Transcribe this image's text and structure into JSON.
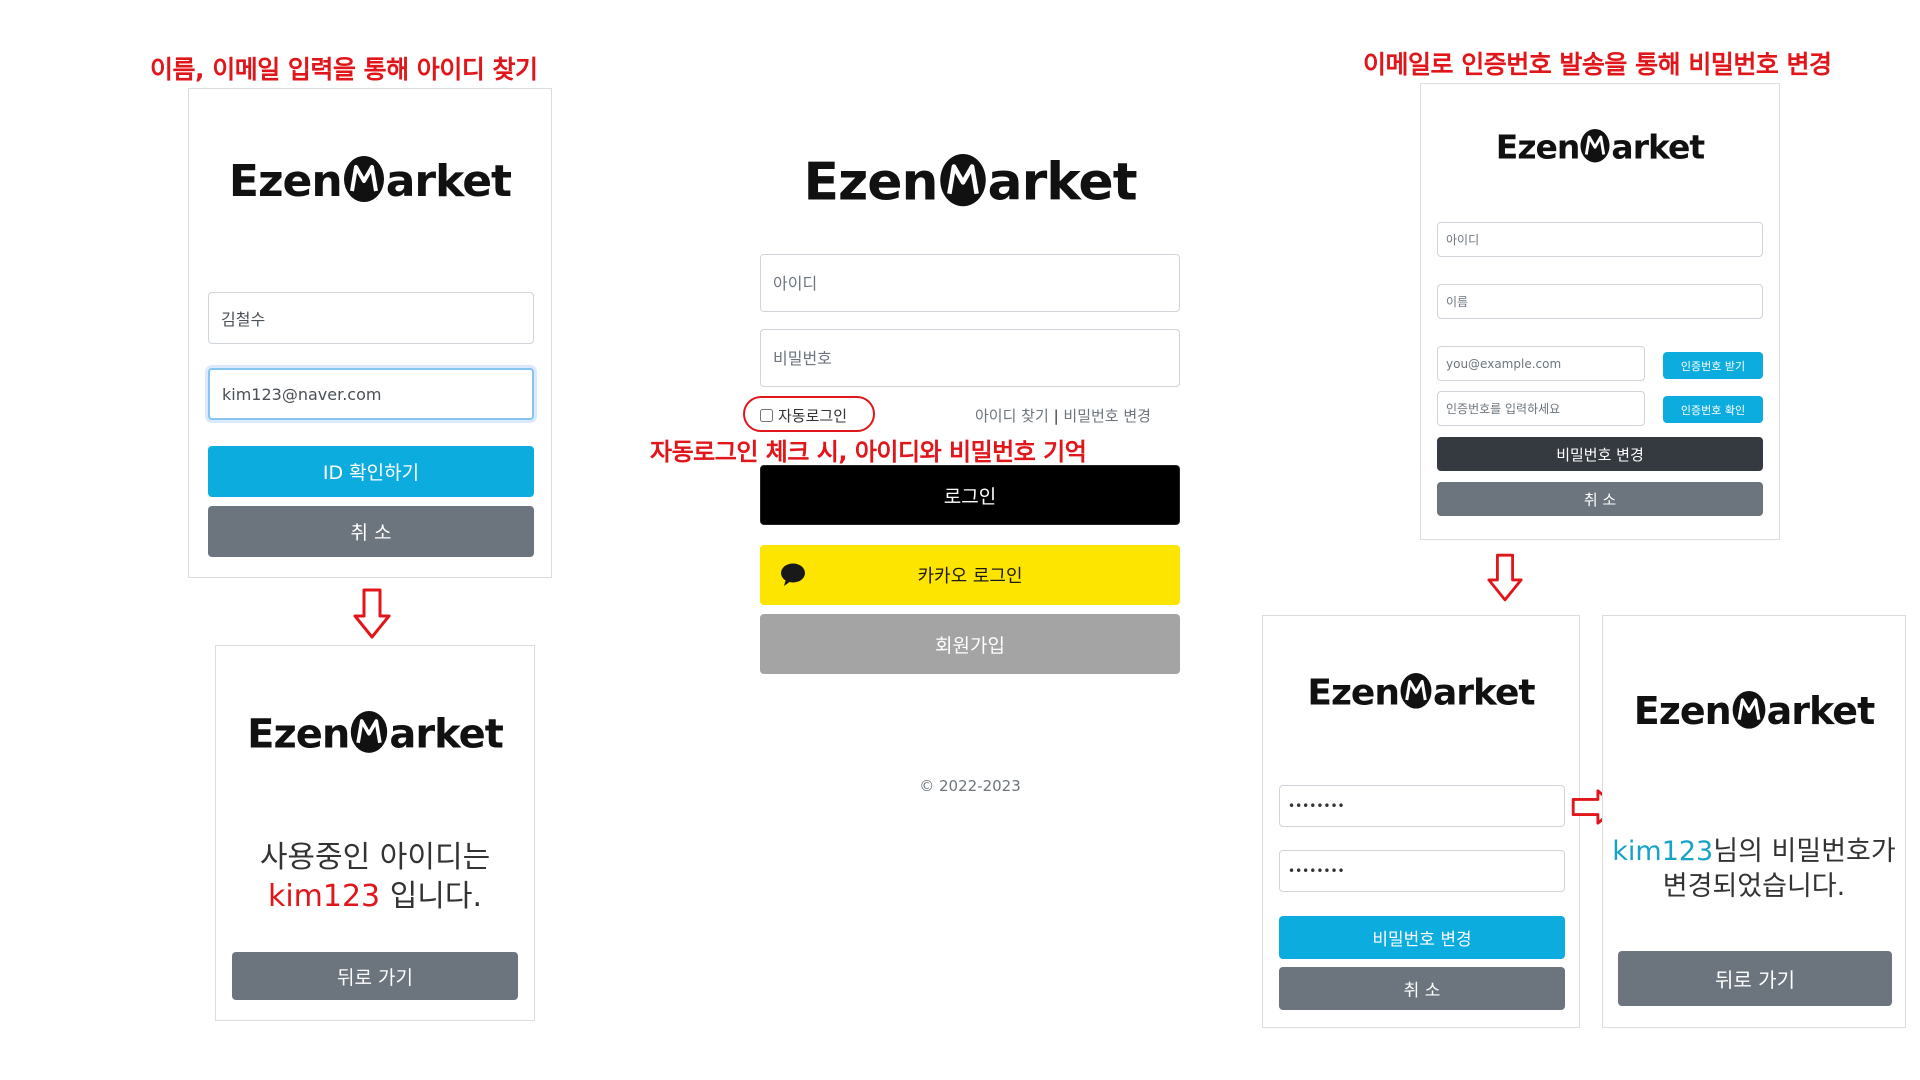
{
  "annotations": {
    "find_id": "이름, 이메일 입력을 통해 아이디 찾기",
    "auto_login": "자동로그인 체크 시, 아이디와 비밀번호 기억",
    "reset_pw": "이메일로 인증번호 발송을 통해 비밀번호 변경"
  },
  "logo": {
    "before": "Ezen",
    "after": "arket"
  },
  "find_id": {
    "name_value": "김철수",
    "email_value": "kim123@naver.com",
    "confirm_label": "ID 확인하기",
    "cancel_label": "취 소"
  },
  "find_id_result": {
    "line1": "사용중인 아이디는",
    "user_id": "kim123",
    "line2_suffix": " 입니다.",
    "back_label": "뒤로 가기"
  },
  "login": {
    "id_placeholder": "아이디",
    "pw_placeholder": "비밀번호",
    "auto_login_label": "자동로그인",
    "find_id_link": "아이디 찾기",
    "separator": "|",
    "change_pw_link": "비밀번호 변경",
    "login_label": "로그인",
    "kakao_label": "카카오 로그인",
    "signup_label": "회원가입",
    "footer": "© 2022-2023"
  },
  "reset_pw": {
    "id_placeholder": "아이디",
    "name_placeholder": "이름",
    "email_placeholder": "you@example.com",
    "get_code_label": "인증번호 받기",
    "code_placeholder": "인증번호를 입력하세요",
    "verify_code_label": "인증번호 확인",
    "change_label": "비밀번호 변경",
    "cancel_label": "취 소"
  },
  "new_pw": {
    "pw1_value": "••••••••",
    "pw2_value": "••••••••",
    "change_label": "비밀번호 변경",
    "cancel_label": "취 소"
  },
  "pw_result": {
    "user_id": "kim123",
    "line1_suffix": "님의 비밀번호가",
    "line2": "변경되었습니다.",
    "back_label": "뒤로 가기"
  },
  "colors": {
    "annotation_red": "#e0161b",
    "primary_cyan": "#0dacdf",
    "secondary_gray": "#6c757d",
    "kakao_yellow": "#fee500"
  }
}
